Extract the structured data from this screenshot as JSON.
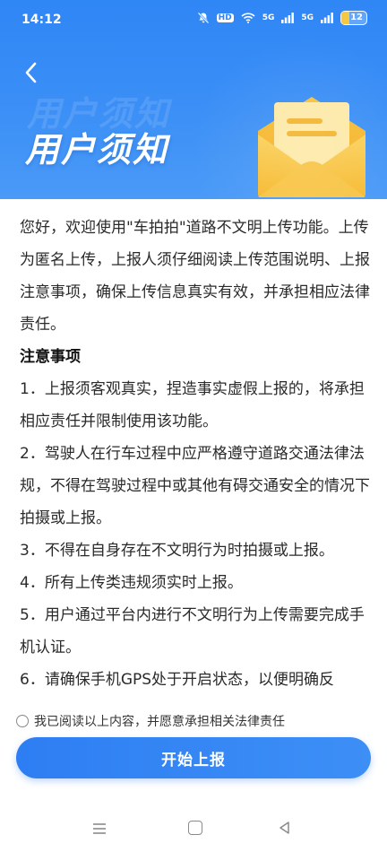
{
  "status_bar": {
    "time": "14:12",
    "hd_label": "HD",
    "net1": "5G",
    "net2": "5G",
    "battery": "12",
    "icons": [
      "mute-bell-icon",
      "hd-icon",
      "wifi-icon",
      "signal-icon",
      "signal-icon",
      "battery-icon"
    ]
  },
  "header": {
    "title": "用户须知",
    "title_ghost": "用户须知",
    "back_icon": "chevron-left-icon",
    "illustration": "envelope-icon",
    "colors": {
      "primary": "#2f86f5",
      "envelope": "#f5b82e"
    }
  },
  "notice": {
    "intro": "您好，欢迎使用\"车拍拍\"道路不文明上传功能。上传为匿名上传，上报人须仔细阅读上传范围说明、上报注意事项，确保上传信息真实有效，并承担相应法律责任。",
    "heading": "注意事项",
    "items": [
      "1．上报须客观真实，捏造事实虚假上报的，将承担相应责任并限制使用该功能。",
      "2．驾驶人在行车过程中应严格遵守道路交通法律法规，不得在驾驶过程中或其他有碍交通安全的情况下拍摄或上报。",
      "3．不得在自身存在不文明行为时拍摄或上报。",
      "4．所有上传类违规须实时上报。",
      "5．用户通过平台内进行不文明行为上传需要完成手机认证。",
      "6．请确保手机GPS处于开启状态，以便明确反"
    ]
  },
  "agreement": {
    "label": "我已阅读以上内容，并愿意承担相关法律责任",
    "checked": false
  },
  "primary_button": {
    "label": "开始上报"
  },
  "nav_bar": {
    "icons": [
      "menu-icon",
      "home-icon",
      "back-triangle-icon"
    ]
  }
}
